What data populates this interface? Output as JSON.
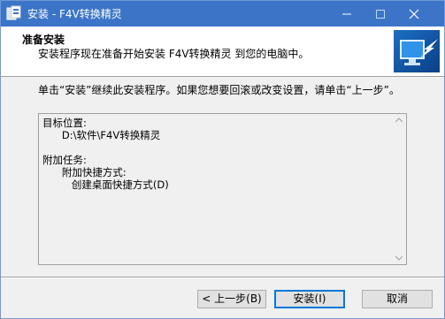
{
  "window": {
    "title": "安装 - F4V转换精灵"
  },
  "header": {
    "title": "准备安装",
    "subtitle": "安装程序现在准备开始安装 F4V转换精灵 到您的电脑中。"
  },
  "description": "单击“安装”继续此安装程序。如果您想要回滚或改变设置，请单击“上一步”。",
  "memo": {
    "lines": [
      "目标位置:",
      "      D:\\软件\\F4V转换精灵",
      "",
      "附加任务:",
      "      附加快捷方式:",
      "         创建桌面快捷方式(D)"
    ]
  },
  "buttons": {
    "back": "< 上一步(B)",
    "install": "安装(I)",
    "cancel": "取消"
  },
  "icons": {
    "app": "installer-app-icon",
    "header_image": "computer-monitor-arrow-icon",
    "minimize": "minimize-icon",
    "maximize": "maximize-icon",
    "close": "close-icon"
  },
  "colors": {
    "titlebar": "#3c75c7",
    "focus_border": "#0078d7"
  }
}
